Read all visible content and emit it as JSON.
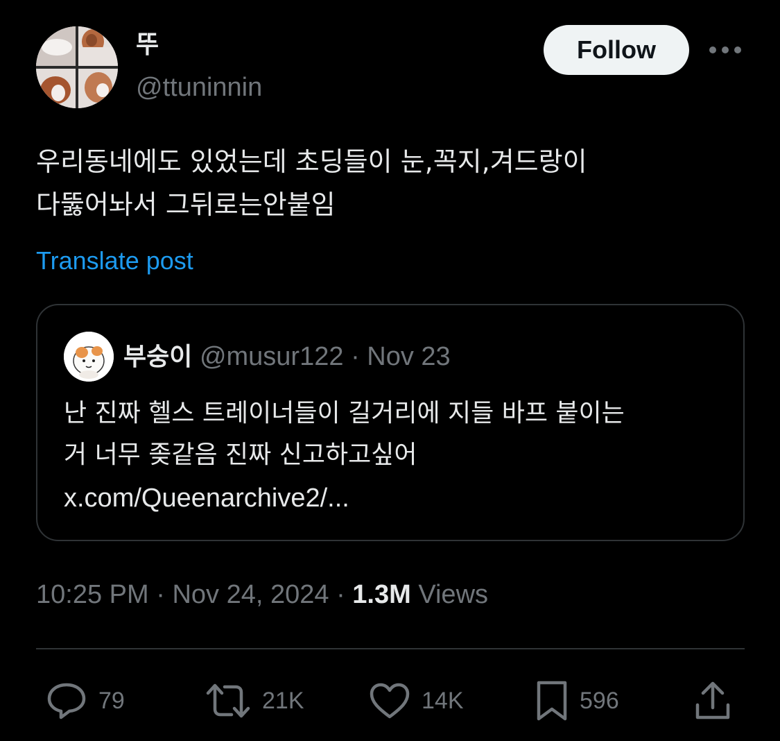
{
  "author": {
    "display_name": "뚜",
    "handle": "@ttuninnin"
  },
  "follow_button_label": "Follow",
  "more_icon": "more-horizontal-icon",
  "tweet": {
    "text_lines": [
      "우리동네에도 있었는데 초딩들이 눈,꼭지,겨드랑이",
      "다뚫어놔서 그뒤로는안붙임"
    ],
    "translate_label": "Translate post"
  },
  "quoted_post": {
    "display_name": "부숭이",
    "handle": "@musur122",
    "separator": "·",
    "date": "Nov 23",
    "text_lines": [
      "난 진짜 헬스 트레이너들이 길거리에 지들 바프 붙이는",
      "거 너무 좆같음 진짜 신고하고싶어"
    ],
    "link": "x.com/Queenarchive2/..."
  },
  "meta": {
    "time": "10:25 PM",
    "separator": "·",
    "date": "Nov 24, 2024",
    "views_count": "1.3M",
    "views_label": "Views"
  },
  "actions": {
    "replies": {
      "icon": "reply-icon",
      "count": "79"
    },
    "reposts": {
      "icon": "repost-icon",
      "count": "21K"
    },
    "likes": {
      "icon": "like-icon",
      "count": "14K"
    },
    "bookmarks": {
      "icon": "bookmark-icon",
      "count": "596"
    },
    "share": {
      "icon": "share-icon"
    }
  },
  "colors": {
    "background": "#000000",
    "text_primary": "#e7e9ea",
    "text_secondary": "#71767b",
    "link": "#1d9bf0",
    "border": "#2f3336",
    "follow_button_bg": "#eff3f4"
  }
}
